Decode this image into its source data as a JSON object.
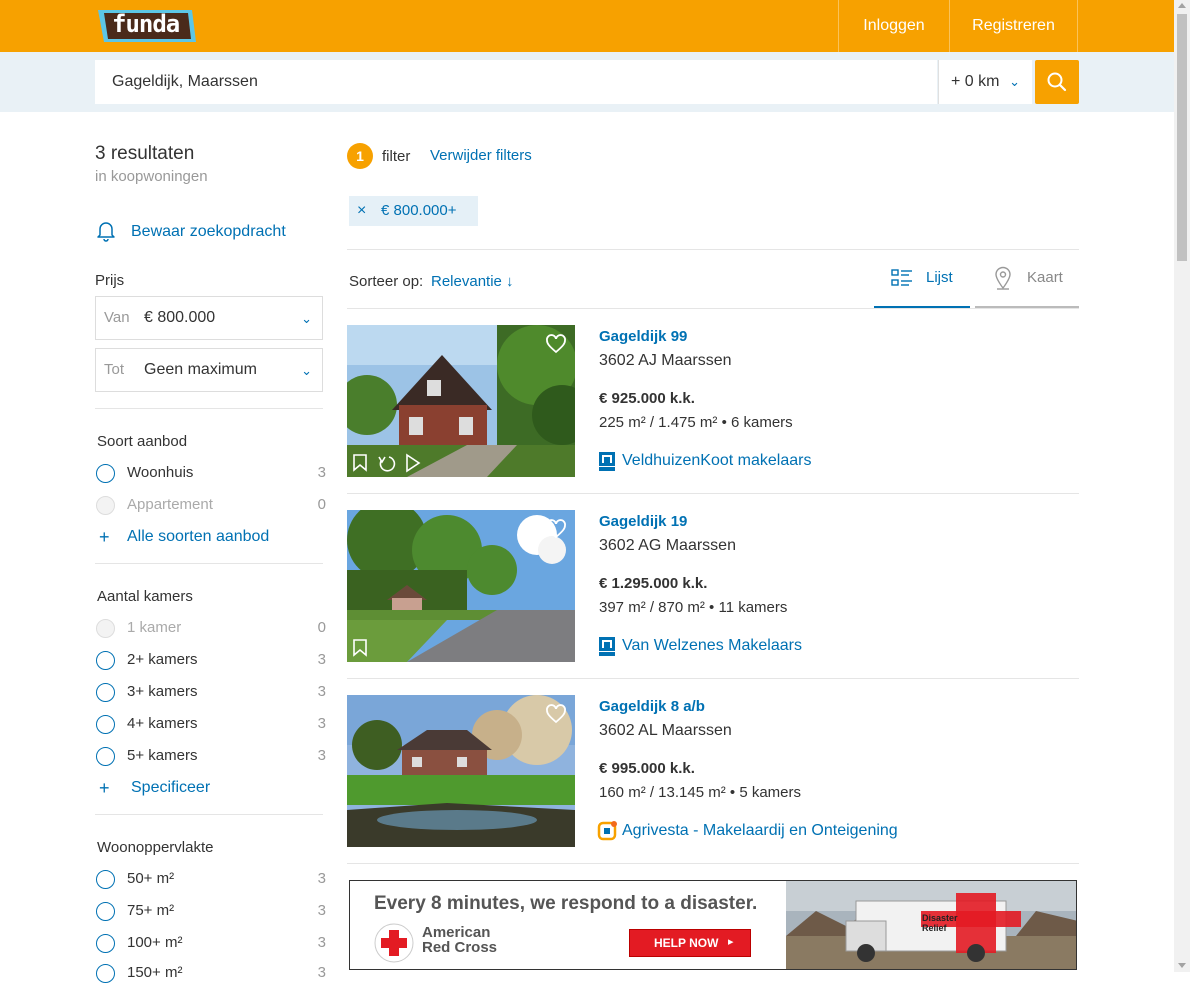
{
  "header": {
    "logo_text": "funda",
    "login_label": "Inloggen",
    "register_label": "Registreren"
  },
  "search": {
    "value": "Gageldijk, Maarssen",
    "radius": "+ 0 km"
  },
  "sidebar": {
    "results_count": "3 resultaten",
    "results_context": "in koopwoningen",
    "save_search_label": "Bewaar zoekopdracht",
    "price": {
      "title": "Prijs",
      "from_label": "Van",
      "from_value": "€ 800.000",
      "to_label": "Tot",
      "to_value": "Geen maximum"
    },
    "offer_type": {
      "title": "Soort aanbod",
      "options": [
        {
          "label": "Woonhuis",
          "count": "3"
        },
        {
          "label": "Appartement",
          "count": "0"
        }
      ],
      "more_label": "Alle soorten aanbod"
    },
    "rooms": {
      "title": "Aantal kamers",
      "options": [
        {
          "label": "1 kamer",
          "count": "0"
        },
        {
          "label": "2+ kamers",
          "count": "3"
        },
        {
          "label": "3+ kamers",
          "count": "3"
        },
        {
          "label": "4+ kamers",
          "count": "3"
        },
        {
          "label": "5+ kamers",
          "count": "3"
        }
      ],
      "more_label": "Specificeer"
    },
    "living_area": {
      "title": "Woonoppervlakte",
      "options": [
        {
          "label": "50+ m²",
          "count": "3"
        },
        {
          "label": "75+ m²",
          "count": "3"
        },
        {
          "label": "100+ m²",
          "count": "3"
        },
        {
          "label": "150+ m²",
          "count": "3"
        }
      ]
    }
  },
  "filters": {
    "count": "1",
    "label": "filter",
    "remove_label": "Verwijder filters",
    "chips": [
      "€ 800.000+"
    ]
  },
  "sort": {
    "label": "Sorteer op:",
    "value": "Relevantie ↓"
  },
  "view_tabs": {
    "list_label": "Lijst",
    "map_label": "Kaart"
  },
  "listings": [
    {
      "title": "Gageldijk 99",
      "address": "3602 AJ Maarssen",
      "price": "€ 925.000 k.k.",
      "area": "225 m² / 1.475 m²",
      "rooms": "6 kamers",
      "agent": "VeldhuizenKoot makelaars"
    },
    {
      "title": "Gageldijk 19",
      "address": "3602 AG Maarssen",
      "price": "€ 1.295.000 k.k.",
      "area": "397 m² / 870 m²",
      "rooms": "11 kamers",
      "agent": "Van Welzenes Makelaars"
    },
    {
      "title": "Gageldijk 8 a/b",
      "address": "3602 AL Maarssen",
      "price": "€ 995.000 k.k.",
      "area": "160 m² / 13.145 m²",
      "rooms": "5 kamers",
      "agent": "Agrivesta - Makelaardij en Onteigening"
    }
  ],
  "ad": {
    "headline": "Every 8 minutes, we respond to a disaster.",
    "org_line1": "American",
    "org_line2": "Red Cross",
    "cta": "HELP NOW",
    "vehicle_line1": "Disaster",
    "vehicle_line2": "Relief"
  },
  "colors": {
    "brand_orange": "#f7a100",
    "link_blue": "#0071b3"
  }
}
